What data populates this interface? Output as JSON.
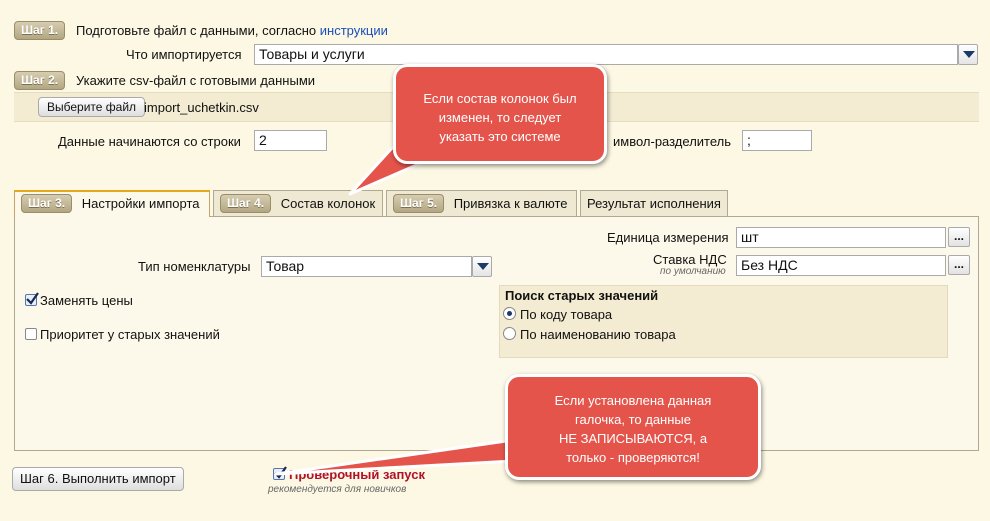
{
  "step1": {
    "badge": "Шаг 1.",
    "text": "Подготовьте файл с данными, согласно",
    "link": "инструкции",
    "what_label": "Что импортируется",
    "what_value": "Товары и услуги"
  },
  "step2": {
    "badge": "Шаг 2.",
    "text": "Укажите csv-файл с готовыми данными",
    "choose_button": "Выберите файл",
    "file_name": "import_uchetkin.csv"
  },
  "params": {
    "start_row_label": "Данные начинаются со строки",
    "start_row_value": "2",
    "separator_label": "имвол-разделитель",
    "separator_value": ";"
  },
  "tabs": [
    {
      "badge": "Шаг 3.",
      "label": "Настройки импорта",
      "active": true
    },
    {
      "badge": "Шаг 4.",
      "label": "Состав колонок",
      "active": false
    },
    {
      "badge": "Шаг 5.",
      "label": "Привязка к валюте",
      "active": false
    },
    {
      "badge": "",
      "label": "Результат исполнения",
      "active": false
    }
  ],
  "settings": {
    "unit_label": "Единица измерения",
    "unit_value": "шт",
    "nomenclature_label": "Тип номенклатуры",
    "nomenclature_value": "Товар",
    "vat_label": "Ставка НДС",
    "vat_hint": "по умолчанию",
    "vat_value": "Без НДС",
    "dots": "...",
    "replace_prices_label": "Заменять цены",
    "replace_prices_checked": true,
    "priority_label": "Приоритет у старых значений",
    "priority_checked": false,
    "search_title": "Поиск старых значений",
    "search_by_code": "По коду товара",
    "search_by_name": "По наименованию товара",
    "search_selected": "code"
  },
  "footer": {
    "run_button": "Шаг 6. Выполнить импорт",
    "test_run_label": "Проверочный запуск",
    "test_run_checked": true,
    "test_run_hint": "рекомендуется для новичков"
  },
  "callouts": {
    "top": [
      "Если состав колонок был",
      "изменен, то следует",
      "указать это системе"
    ],
    "bottom": [
      "Если установлена данная",
      "галочка, то данные",
      "НЕ ЗАПИСЫВАЮТСЯ, а",
      "только - проверяются!"
    ]
  },
  "colors": {
    "background": "#fcf8e4",
    "badge": "#b3a782",
    "callout": "#e5544b",
    "link": "#1a4fb8",
    "test_run_label": "#b0102a",
    "tab_active_accent": "#e8a520"
  }
}
